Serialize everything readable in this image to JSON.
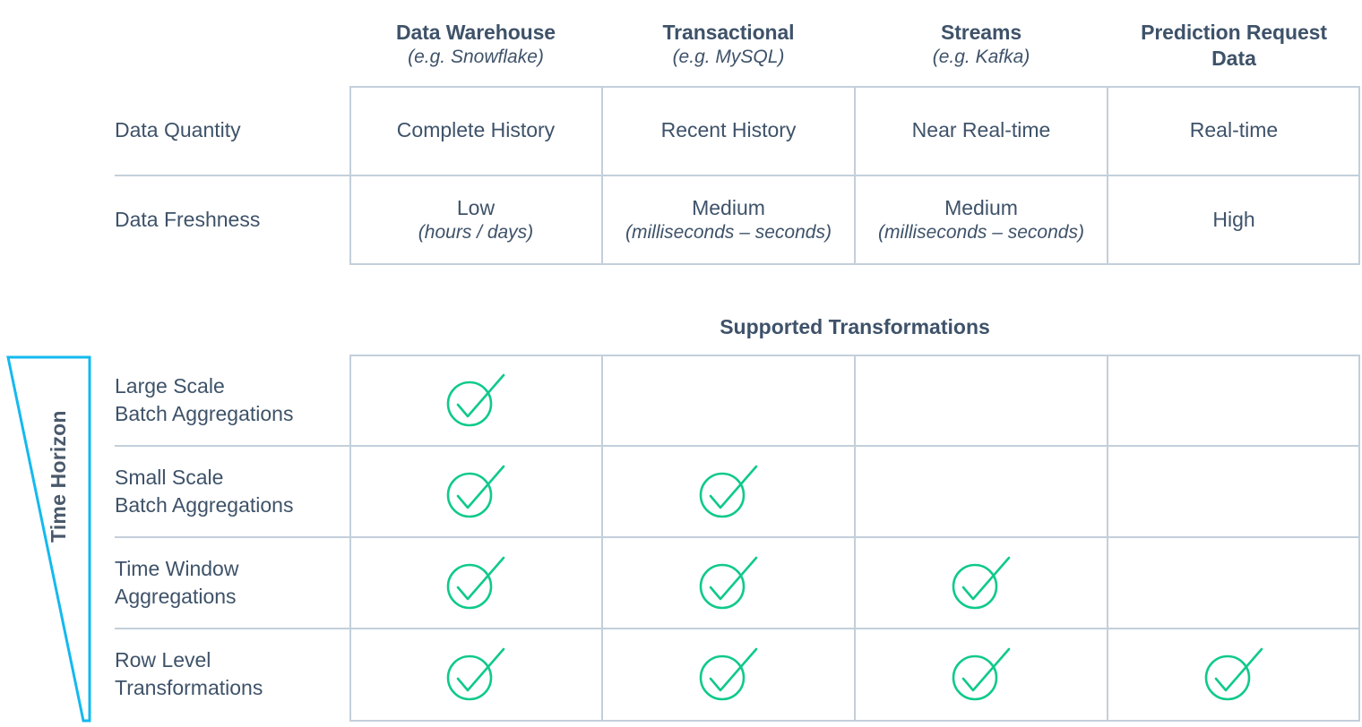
{
  "colors": {
    "text": "#3e5269",
    "grid": "#c3cfda",
    "check_green": "#0fc98c",
    "triangle_blue": "#14b9ef"
  },
  "columns": [
    {
      "title": "Data Warehouse",
      "example": "(e.g. Snowflake)"
    },
    {
      "title": "Transactional",
      "example": "(e.g. MySQL)"
    },
    {
      "title": "Streams",
      "example": "(e.g. Kafka)"
    },
    {
      "title": "Prediction Request",
      "example": "Data"
    }
  ],
  "top_table": {
    "rows": [
      {
        "label": "Data Quantity",
        "cells": [
          {
            "main": "Complete History",
            "sub": ""
          },
          {
            "main": "Recent History",
            "sub": ""
          },
          {
            "main": "Near Real-time",
            "sub": ""
          },
          {
            "main": "Real-time",
            "sub": ""
          }
        ]
      },
      {
        "label": "Data Freshness",
        "cells": [
          {
            "main": "Low",
            "sub": "(hours / days)"
          },
          {
            "main": "Medium",
            "sub": "(milliseconds – seconds)"
          },
          {
            "main": "Medium",
            "sub": "(milliseconds – seconds)"
          },
          {
            "main": "High",
            "sub": ""
          }
        ]
      }
    ]
  },
  "section_title": "Supported Transformations",
  "time_horizon": {
    "label": "Time Horizon"
  },
  "bottom_table": {
    "rows": [
      {
        "line1": "Large Scale",
        "line2": "Batch Aggregations",
        "checks": [
          true,
          false,
          false,
          false
        ]
      },
      {
        "line1": "Small Scale",
        "line2": "Batch Aggregations",
        "checks": [
          true,
          true,
          false,
          false
        ]
      },
      {
        "line1": "Time Window",
        "line2": "Aggregations",
        "checks": [
          true,
          true,
          true,
          false
        ]
      },
      {
        "line1": "Row Level",
        "line2": "Transformations",
        "checks": [
          true,
          true,
          true,
          true
        ]
      }
    ]
  },
  "icons": {
    "check": "check-circle-icon"
  }
}
